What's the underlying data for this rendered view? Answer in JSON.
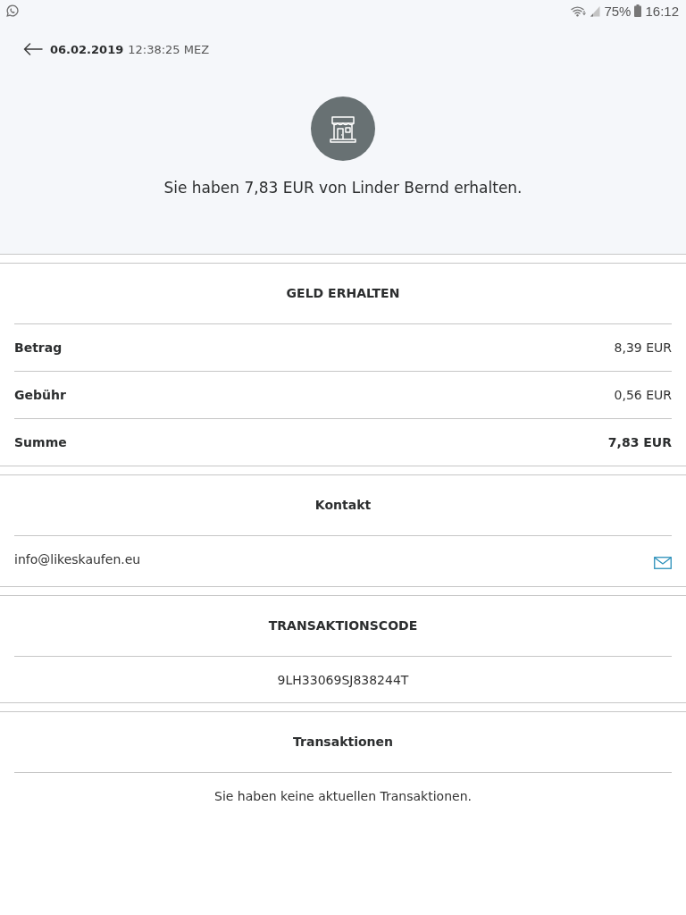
{
  "status_bar": {
    "battery": "75%",
    "time": "16:12"
  },
  "header": {
    "date": "06.02.2019",
    "time": "12:38:25 MEZ",
    "message": "Sie haben 7,83 EUR von Linder Bernd erhalten."
  },
  "sections": [
    {
      "kind": "details",
      "title": "GELD ERHALTEN",
      "rows": [
        {
          "label": "Betrag",
          "value": "8,39 EUR",
          "emphasized": false
        },
        {
          "label": "Gebühr",
          "value": "0,56 EUR",
          "emphasized": false
        },
        {
          "label": "Summe",
          "value": "7,83 EUR",
          "emphasized": true
        }
      ]
    },
    {
      "kind": "contact",
      "title": "Kontakt",
      "email": "info@likeskaufen.eu"
    },
    {
      "kind": "code",
      "title": "TRANSAKTIONSCODE",
      "code": "9LH33069SJ838244T"
    },
    {
      "kind": "empty",
      "title": "Transaktionen",
      "message": "Sie haben keine aktuellen Transaktionen."
    }
  ]
}
